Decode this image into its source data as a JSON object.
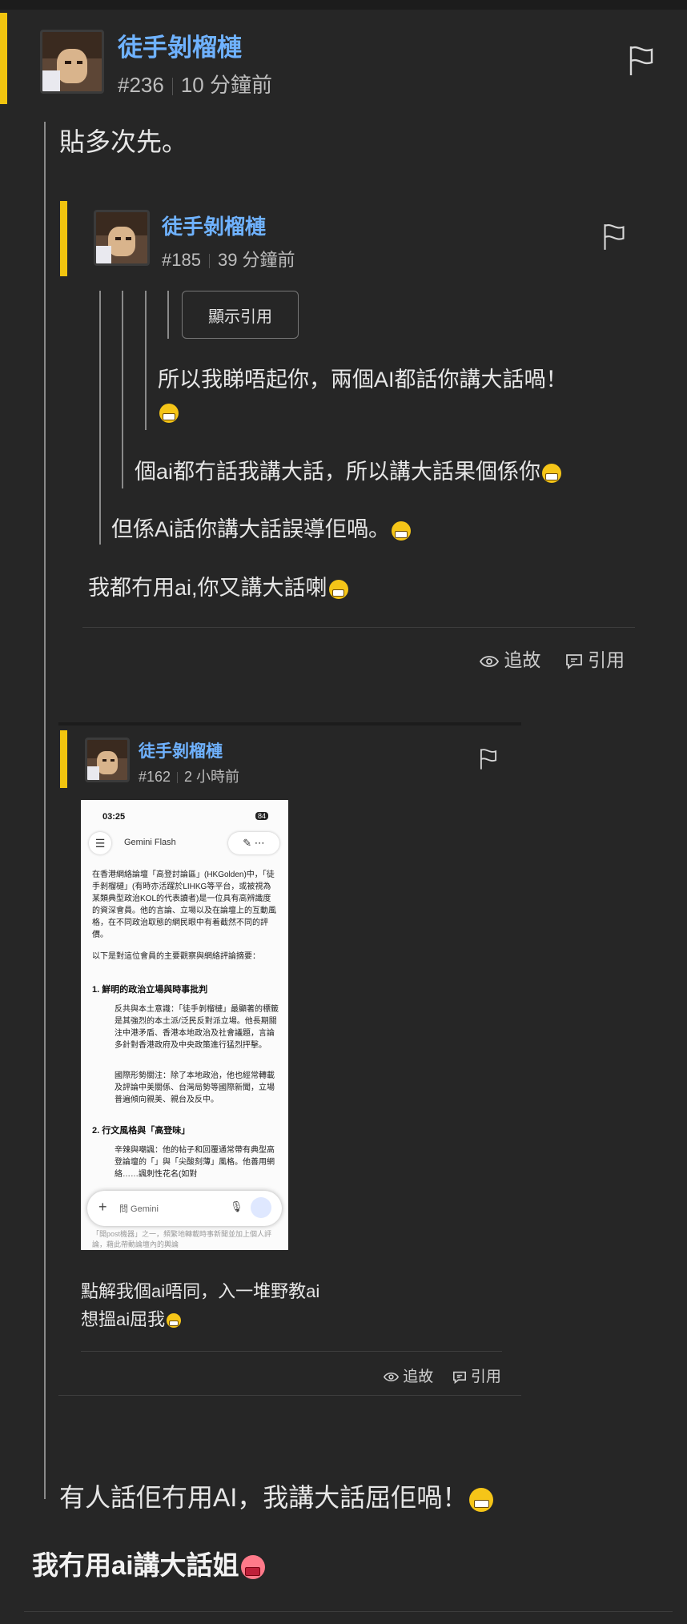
{
  "post": {
    "username": "徒手剝榴槤",
    "number": "#236",
    "time": "10 分鐘前",
    "body_first": "貼多次先。",
    "body_last": "有人話佢冇用AI，我講大話屈佢喎！",
    "reply_text": "我冇用ai講大話姐"
  },
  "quote1": {
    "username": "徒手剝榴槤",
    "number": "#185",
    "time": "39 分鐘前",
    "show_quote_label": "顯示引用",
    "nested_line1": "所以我睇唔起你，兩個AI都話你講大話喎！",
    "nested_line2": "個ai都冇話我講大話，所以講大話果個係你",
    "nested_line3": "但係Ai話你講大話誤導佢喎。",
    "body": "我都冇用ai,你又講大話喇",
    "action_follow": "追故",
    "action_quote": "引用"
  },
  "quote2": {
    "username": "徒手剝榴槤",
    "number": "#162",
    "time": "2 小時前",
    "body_line1": "點解我個ai唔同，入一堆野教ai",
    "body_line2": "想搵ai屈我",
    "action_follow": "追故",
    "action_quote": "引用"
  },
  "screenshot": {
    "time": "03:25",
    "battery": "84",
    "app_title": "Gemini Flash",
    "intro": "在香港網絡論壇「高登討論區」(HKGolden)中，「徒手剝榴槤」(有時亦活躍於LIHKG等平台，或被視為某類典型政治KOL的代表讀者)是一位具有高辨識度的資深會員。他的言論、立場以及在論壇上的互動風格，在不同政治取態的網民眼中有着截然不同的評價。",
    "summary_line": "以下是對這位會員的主要觀察與網絡評論摘要：",
    "heading1": "1. 鮮明的政治立場與時事批判",
    "bullet1": "反共與本土意識：「徒手剝榴槤」最顯著的標籤是其強烈的本土派/泛民反對派立場。他長期關注中港矛盾、香港本地政治及社會議題，言論多針對香港政府及中央政策進行猛烈抨擊。",
    "bullet2": "國際形勢關注：除了本地政治，他也經常轉載及評論中美關係、台灣局勢等國際新聞，立場普遍傾向親美、親台及反中。",
    "heading2": "2. 行文風格與「高登味」",
    "bullet3": "辛辣與嘲諷：他的帖子和回覆通常帶有典型高登論壇的「」與「尖酸刻薄」風格。他善用網絡……諷刺性花名(如對",
    "input_placeholder": "問 Gemini",
    "footer": "「開post機器」之一，頻繁地轉載時事新聞並加上個人評論，藉此帶動論壇內的輿論"
  },
  "colors": {
    "background": "#262626",
    "username": "#6fb2ff",
    "accent_bar": "#f1c40f",
    "text": "#e6e6e6",
    "meta": "#bdbdbd"
  },
  "icons": [
    "flag-icon",
    "eye-icon",
    "quote-icon",
    "grin-emoji",
    "devil-emoji"
  ]
}
